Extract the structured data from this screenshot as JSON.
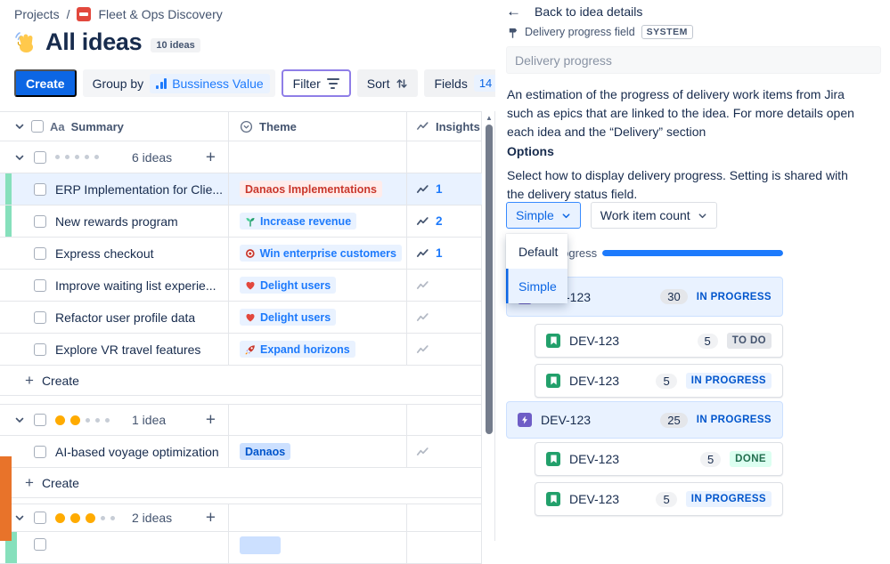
{
  "breadcrumb": {
    "projects": "Projects",
    "separator": "/",
    "project": "Fleet & Ops Discovery"
  },
  "header": {
    "title": "All ideas",
    "count_badge": "10 ideas",
    "title_icon": "waving-hand"
  },
  "toolbar": {
    "create_label": "Create",
    "group_by_label": "Group by",
    "group_by_value": "Bussiness Value",
    "filter_label": "Filter",
    "sort_label": "Sort",
    "fields_label": "Fields",
    "fields_count": "14",
    "refresh_icon": "A"
  },
  "icons": {
    "summary_type": "Aa",
    "scroll_up": "▲"
  },
  "table": {
    "columns": {
      "summary": "Summary",
      "theme": "Theme",
      "insights": "Insights"
    },
    "groups": [
      {
        "rating": 0,
        "count_label": "6 ideas",
        "create_label": "Create",
        "ideas": [
          {
            "title": "ERP Implementation for Clie...",
            "theme": {
              "label": "Danaos Implementations",
              "style": "red",
              "icon": ""
            },
            "insights": "1",
            "selected": true,
            "accent": true
          },
          {
            "title": "New rewards program",
            "theme": {
              "label": "Increase revenue",
              "style": "blue",
              "icon": "seedling-icon"
            },
            "insights": "2",
            "accent": true
          },
          {
            "title": "Express checkout",
            "theme": {
              "label": "Win enterprise customers",
              "style": "blue",
              "icon": "target-icon"
            },
            "insights": "1"
          },
          {
            "title": "Improve waiting list experie...",
            "theme": {
              "label": "Delight users",
              "style": "blue",
              "icon": "heart-icon"
            },
            "insights": null
          },
          {
            "title": "Refactor user profile data",
            "theme": {
              "label": "Delight users",
              "style": "blue",
              "icon": "heart-icon"
            },
            "insights": null
          },
          {
            "title": "Explore VR travel features",
            "theme": {
              "label": "Expand horizons",
              "style": "blue",
              "icon": "rocket-icon"
            },
            "insights": null
          }
        ]
      },
      {
        "rating": 2,
        "count_label": "1 idea",
        "create_label": "Create",
        "ideas": [
          {
            "title": "AI-based voyage optimization",
            "theme": {
              "label": "Danaos",
              "style": "blue-strong",
              "icon": ""
            },
            "insights": null
          }
        ]
      },
      {
        "rating": 3,
        "count_label": "2 ideas",
        "ideas": []
      }
    ]
  },
  "panel": {
    "back_label": "Back to idea details",
    "field_label": "Delivery progress field",
    "field_badge": "SYSTEM",
    "name_value": "Delivery progress",
    "description": "An estimation of the progress of delivery work items from Jira such as epics that are linked to the idea. For more details open each idea and the “Delivery” section",
    "options_title": "Options",
    "options_description": "Select how to display delivery progress. Setting is shared with the delivery status field.",
    "display_dropdown_value": "Simple",
    "count_dropdown_value": "Work item count",
    "menu_items": [
      {
        "label": "Default",
        "selected": false
      },
      {
        "label": "Simple",
        "selected": true
      }
    ],
    "preview_label": "Delivery progress",
    "progress_percent": 100,
    "cards": [
      {
        "key": "DEV-123",
        "type": "epic",
        "count": "30",
        "status": "IN PROGRESS"
      },
      {
        "key": "DEV-123",
        "type": "story",
        "count": "5",
        "status": "TO DO"
      },
      {
        "key": "DEV-123",
        "type": "story",
        "count": "5",
        "status": "IN PROGRESS"
      },
      {
        "key": "DEV-123",
        "type": "epic",
        "count": "25",
        "status": "IN PROGRESS"
      },
      {
        "key": "DEV-123",
        "type": "story",
        "count": "5",
        "status": "DONE"
      },
      {
        "key": "DEV-123",
        "type": "story",
        "count": "5",
        "status": "IN PROGRESS"
      }
    ]
  },
  "colors": {
    "accent_blue": "#0C66E4",
    "progress_blue": "#1D7AFC",
    "selected_row": "#E9F2FF",
    "green_accent": "#86E0BC",
    "orange_strip": "#E8732A",
    "filter_outline": "#8F7EE7",
    "rating_filled": "#FFAB00"
  }
}
